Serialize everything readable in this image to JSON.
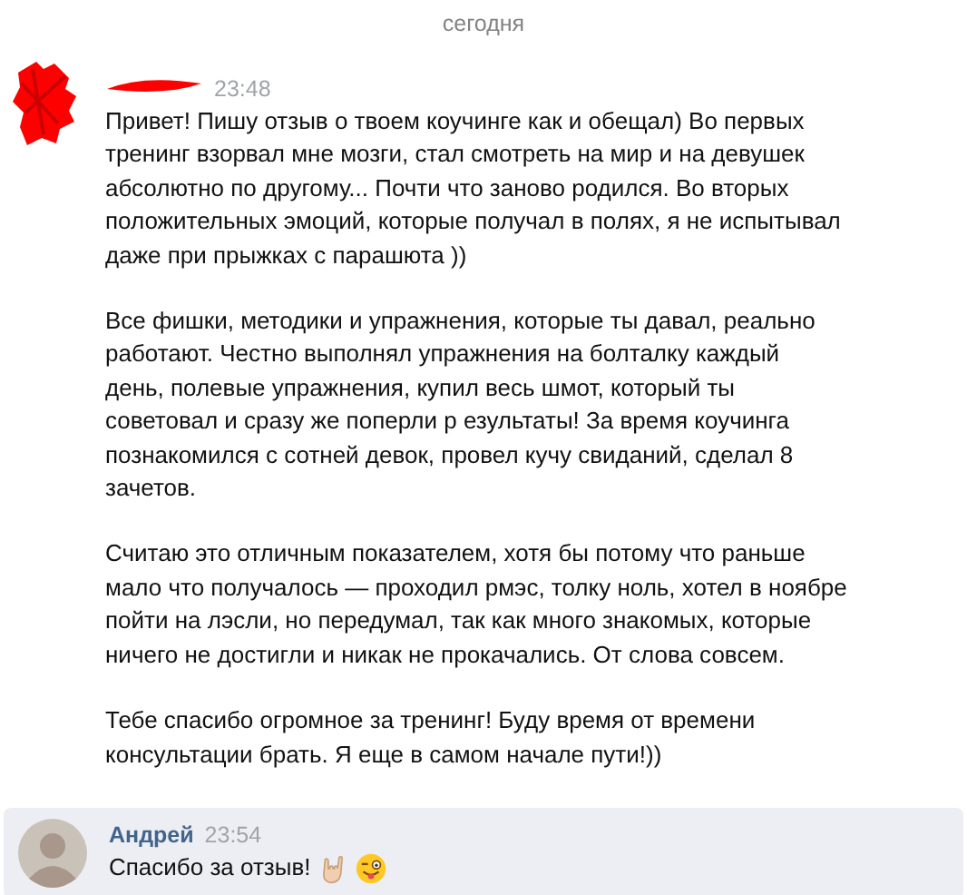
{
  "date_divider": "сегодня",
  "messages": [
    {
      "kind": "redacted",
      "time": "23:48",
      "paragraphs": [
        [
          "Привет! Пишу отзыв о твоем коучинге как и обещал) Во первых",
          "тренинг взорвал мне мозги, стал смотреть на мир и на девушек",
          "абсолютно по другому... Почти что заново родился. Во вторых",
          "положительных эмоций, которые получал в полях, я не испытывал",
          "даже при прыжках с парашюта ))"
        ],
        [
          "Все фишки, методики и упражнения, которые ты давал, реально",
          "работают. Честно выполнял упражнения на болталку каждый",
          "день, полевые упражнения, купил весь шмот, который ты",
          "советовал и сразу же поперли р езультаты! За время коучинга",
          "познакомился с сотней девок, провел кучу свиданий, сделал 8",
          "зачетов."
        ],
        [
          "Считаю это отличным показателем, хотя бы потому что раньше",
          "мало что получалось — проходил рмэс, толку ноль, хотел в ноябре",
          "пойти на лэсли, но передумал, так как много знакомых, которые",
          "ничего не достигли и никак не прокачались. От слова совсем."
        ],
        [
          "Тебе спасибо огромное за тренинг! Буду время от времени",
          "консультации брать. Я еще в самом начале пути!))"
        ]
      ],
      "highlighted": false
    },
    {
      "kind": "named",
      "author": "Андрей",
      "time": "23:54",
      "paragraphs": [
        [
          "Спасибо за отзыв!"
        ]
      ],
      "emoji": [
        {
          "kind": "rock-hand"
        },
        {
          "kind": "wink-face"
        }
      ],
      "highlighted": true
    }
  ]
}
